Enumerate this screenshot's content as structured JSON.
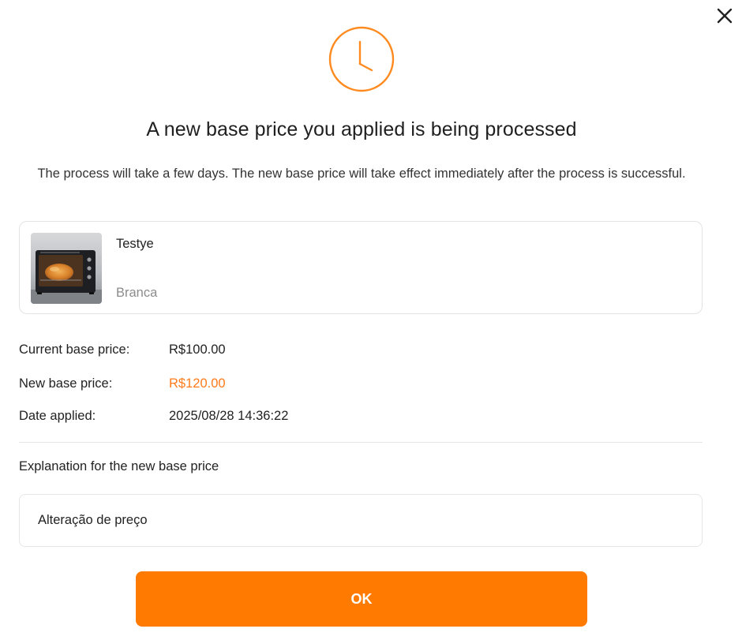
{
  "dialog": {
    "close_icon": "close-icon",
    "status_icon": "clock-icon",
    "title": "A new base price you applied is being processed",
    "subtitle": "The process will take a few days. The new base price will take effect immediately after the process is successful."
  },
  "product": {
    "thumbnail_icon": "oven-product-image",
    "name": "Testye",
    "variant": "Branca"
  },
  "info": {
    "current_price_label": "Current base price:",
    "current_price_value": "R$100.00",
    "new_price_label": "New base price:",
    "new_price_value": "R$120.00",
    "date_label": "Date applied:",
    "date_value": "2025/08/28 14:36:22"
  },
  "explanation": {
    "label": "Explanation for the new base price",
    "value": "Alteração de preço"
  },
  "actions": {
    "ok_label": "OK"
  },
  "colors": {
    "accent": "#ff7a00",
    "highlight_text": "#ff7a1a",
    "border": "#e3e3e3",
    "muted_text": "#8c8c8c"
  }
}
